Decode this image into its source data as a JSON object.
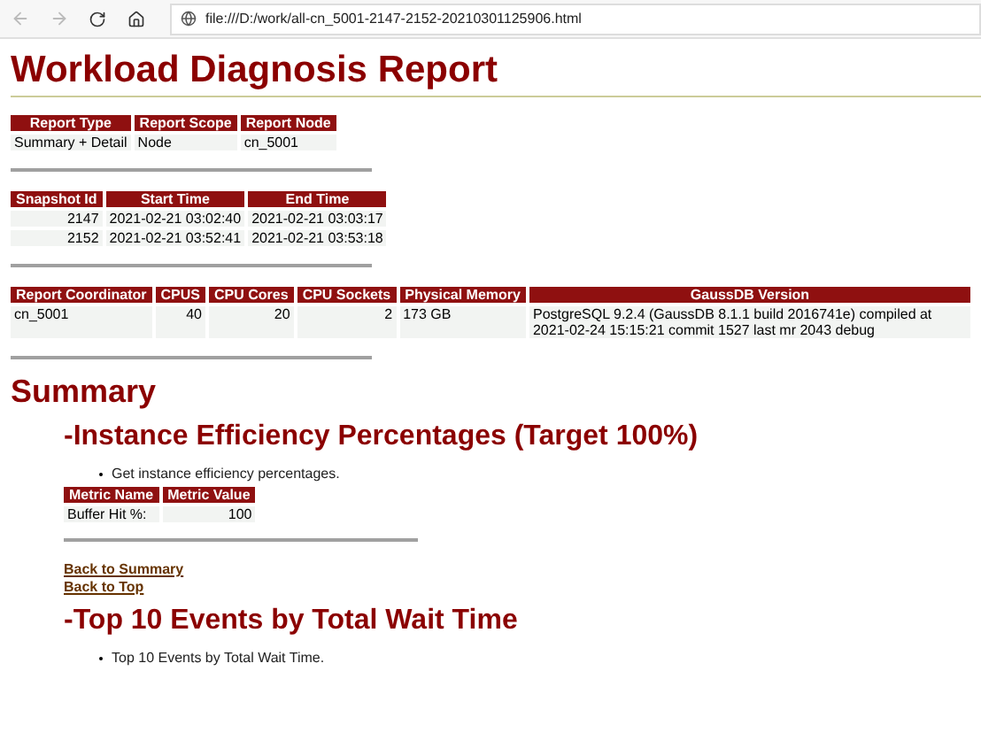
{
  "browser": {
    "back_disabled": true,
    "forward_disabled": true,
    "url": "file:///D:/work/all-cn_5001-2147-2152-20210301125906.html"
  },
  "title": "Workload Diagnosis Report",
  "report_tables": [
    {
      "columns": [
        {
          "label": "Report Type",
          "kind": "text"
        },
        {
          "label": "Report Scope",
          "kind": "text"
        },
        {
          "label": "Report Node",
          "kind": "text"
        }
      ],
      "rows": [
        [
          "Summary + Detail",
          "Node",
          "cn_5001"
        ]
      ]
    },
    {
      "columns": [
        {
          "label": "Snapshot Id",
          "kind": "number"
        },
        {
          "label": "Start Time",
          "kind": "text"
        },
        {
          "label": "End Time",
          "kind": "text"
        }
      ],
      "rows": [
        [
          "2147",
          "2021-02-21 03:02:40",
          "2021-02-21 03:03:17"
        ],
        [
          "2152",
          "2021-02-21 03:52:41",
          "2021-02-21 03:53:18"
        ]
      ]
    },
    {
      "columns": [
        {
          "label": "Report Coordinator",
          "kind": "text"
        },
        {
          "label": "CPUS",
          "kind": "number"
        },
        {
          "label": "CPU Cores",
          "kind": "number"
        },
        {
          "label": "CPU Sockets",
          "kind": "number"
        },
        {
          "label": "Physical Memory",
          "kind": "text"
        },
        {
          "label": "GaussDB Version",
          "kind": "wide"
        }
      ],
      "rows": [
        [
          "cn_5001",
          "40",
          "20",
          "2",
          "173 GB",
          "PostgreSQL 9.2.4 (GaussDB 8.1.1 build 2016741e) compiled at 2021-02-24 15:15:21 commit 1527 last mr 2043 debug"
        ]
      ]
    }
  ],
  "summary_heading": "Summary",
  "sections": [
    {
      "heading": "-Instance Efficiency Percentages (Target 100%)",
      "bullet": "Get instance efficiency percentages.",
      "table": {
        "columns": [
          {
            "label": "Metric Name",
            "kind": "text"
          },
          {
            "label": "Metric Value",
            "kind": "number"
          }
        ],
        "rows": [
          [
            "Buffer Hit %:",
            "100"
          ]
        ]
      },
      "links": [
        "Back to Summary",
        "Back to Top"
      ]
    },
    {
      "heading": "-Top 10 Events by Total Wait Time",
      "bullet": "Top 10 Events by Total Wait Time."
    }
  ]
}
